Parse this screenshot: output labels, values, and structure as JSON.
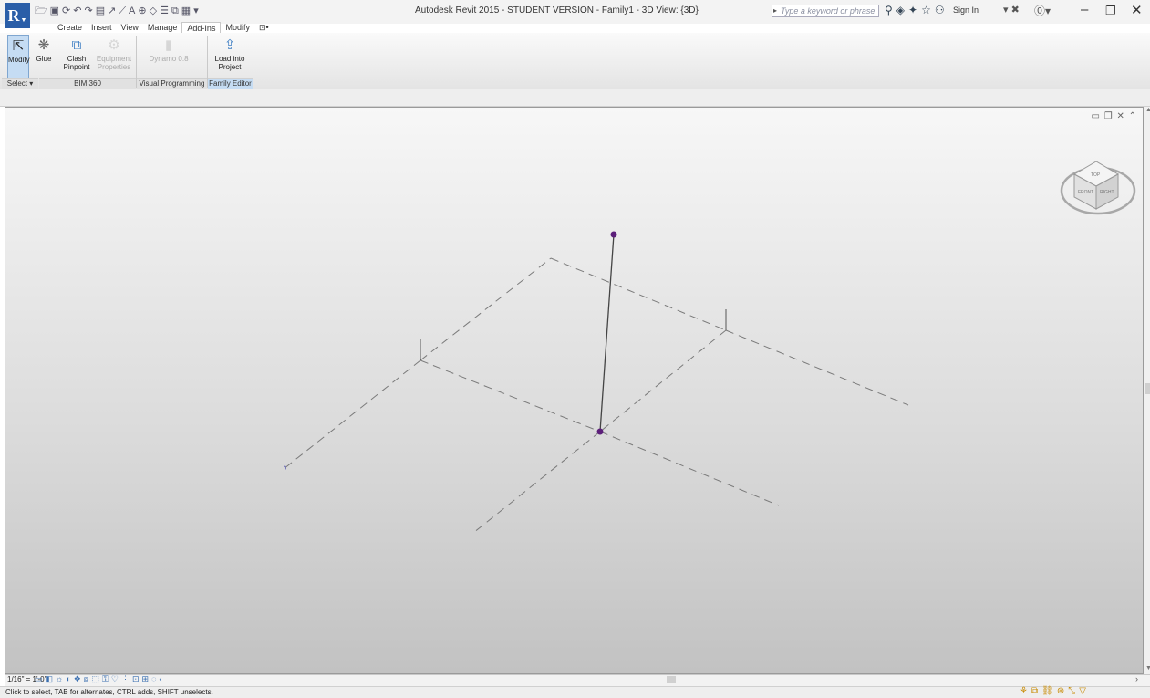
{
  "window": {
    "title": "Autodesk Revit 2015 - STUDENT VERSION -   Family1 - 3D View: {3D}",
    "app_letter": "R",
    "search_placeholder": "Type a keyword or phrase",
    "sign_in": "Sign In"
  },
  "tabs": [
    {
      "label": "Create"
    },
    {
      "label": "Insert"
    },
    {
      "label": "View"
    },
    {
      "label": "Manage"
    },
    {
      "label": "Add-Ins",
      "active": true
    },
    {
      "label": "Modify"
    },
    {
      "label": "⊡•"
    }
  ],
  "ribbon": {
    "modify": "Modify",
    "glue": "Glue",
    "clash_pinpoint_1": "Clash",
    "clash_pinpoint_2": "Pinpoint",
    "equipment_properties_1": "Equipment",
    "equipment_properties_2": "Properties",
    "dynamo": "Dynamo 0.8",
    "load_into_project_1": "Load into",
    "load_into_project_2": "Project"
  },
  "panels": {
    "select": "Select ▾",
    "bim360": "BIM 360",
    "visual_programming": "Visual Programming",
    "family_editor": "Family Editor"
  },
  "view": {
    "scale": "1/16\" = 1'-0\"",
    "viewcube_top": "TOP",
    "viewcube_front": "FRONT",
    "viewcube_right": "RIGHT"
  },
  "status": {
    "text": "Click to select, TAB for alternates, CTRL adds, SHIFT unselects."
  },
  "colors": {
    "point": "#5c1f7a",
    "app_button": "#2a5ea8",
    "ribbon_highlight": "#c5dcf3"
  },
  "icons": [
    "open-icon",
    "save-icon",
    "undo-icon",
    "redo-icon",
    "measure-icon",
    "text-icon",
    "binoculars-icon",
    "star-icon",
    "user-icon",
    "help-icon",
    "exchange-icon"
  ]
}
